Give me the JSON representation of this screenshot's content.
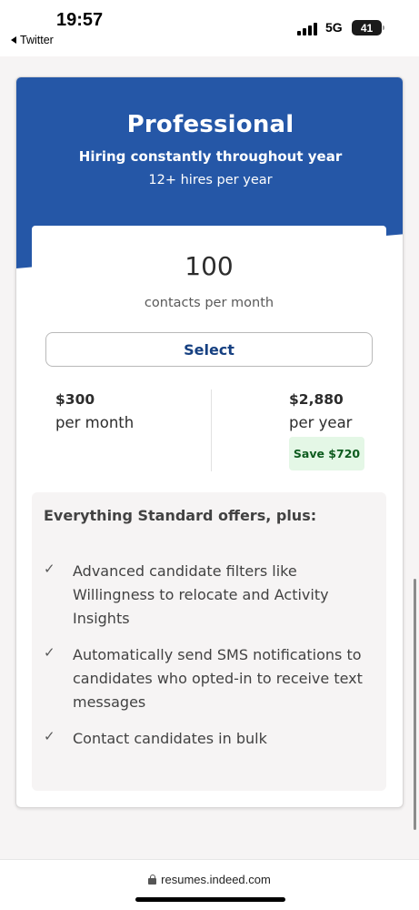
{
  "status_bar": {
    "time": "19:57",
    "back_app": "Twitter",
    "network": "5G",
    "battery": "41"
  },
  "plan": {
    "name": "Professional",
    "tagline": "Hiring constantly throughout year",
    "hires": "12+ hires per year",
    "contacts_count": "100",
    "contacts_label": "contacts per month",
    "select_label": "Select",
    "monthly": {
      "amount": "$300",
      "period": "per month"
    },
    "yearly": {
      "amount": "$2,880",
      "period": "per year",
      "savings": "Save $720"
    }
  },
  "features": {
    "title": "Everything Standard offers, plus:",
    "items": [
      {
        "icon": "check-icon",
        "text": "Advanced candidate filters like Willingness to relocate and Activity Insights"
      },
      {
        "icon": "check-icon",
        "text": "Automatically send SMS notifications to candidates who opted-in to receive text messages"
      },
      {
        "icon": "check-icon",
        "text": "Contact candidates in bulk"
      }
    ]
  },
  "browser": {
    "url": "resumes.indeed.com"
  },
  "colors": {
    "header_blue": "#2557a7",
    "select_text": "#164081",
    "save_badge_bg": "#e4f7e6",
    "save_badge_text": "#0d5b1e",
    "page_bg": "#f6f4f4"
  }
}
